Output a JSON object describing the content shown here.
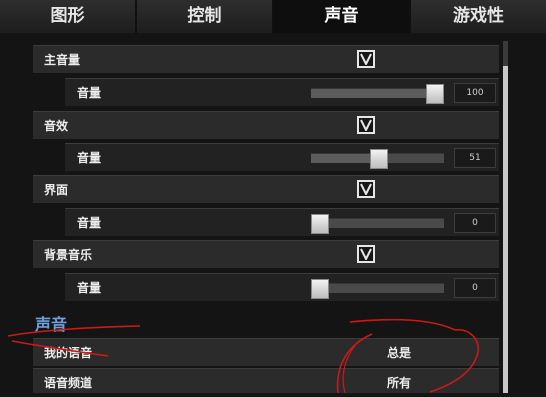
{
  "tabs": [
    {
      "label": "图形",
      "active": false
    },
    {
      "label": "控制",
      "active": false
    },
    {
      "label": "声音",
      "active": true
    },
    {
      "label": "游戏性",
      "active": false
    }
  ],
  "groups": [
    {
      "label": "主音量",
      "enabled": true,
      "sub_label": "音量",
      "volume": 100,
      "volume_text": "100"
    },
    {
      "label": "音效",
      "enabled": true,
      "sub_label": "音量",
      "volume": 51,
      "volume_text": "51"
    },
    {
      "label": "界面",
      "enabled": true,
      "sub_label": "音量",
      "volume": 0,
      "volume_text": "0"
    },
    {
      "label": "背景音乐",
      "enabled": true,
      "sub_label": "音量",
      "volume": 0,
      "volume_text": "0"
    }
  ],
  "voice_section": {
    "title": "声音",
    "options": [
      {
        "label": "我的语音",
        "value": "总是"
      },
      {
        "label": "语音频道",
        "value": "所有"
      }
    ]
  },
  "colors": {
    "accent": "#6fa0dc",
    "annotation": "#d01818"
  }
}
